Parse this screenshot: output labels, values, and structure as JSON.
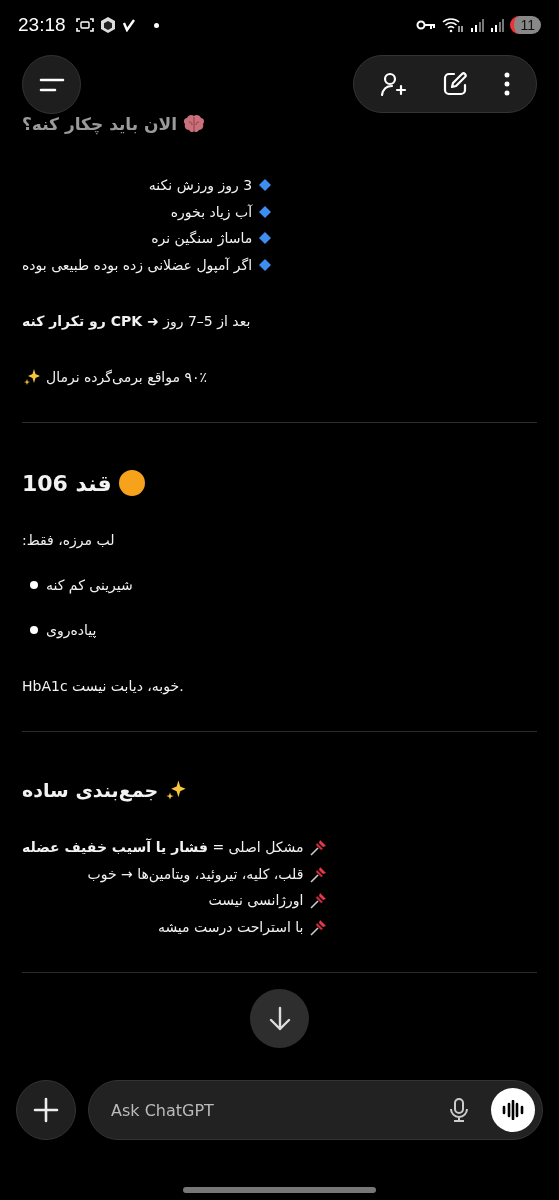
{
  "status_bar": {
    "time": "23:18",
    "battery": "11"
  },
  "sections": [
    {
      "heading": "الان باید چکار کنه؟",
      "tips": [
        "3 روز ورزش نکنه",
        "آب زیاد بخوره",
        "ماساژ سنگین نره",
        "اگر آمپول عضلانی زده بوده طبیعی بوده"
      ],
      "notes": [
        "بعد از 5–7 روز **➜ CPK رو تکرار کنه**",
        "۹۰٪ مواقع برمی‌گرده نرمال"
      ]
    },
    {
      "heading": "قند 106",
      "intro": "لب مرزه، فقط:",
      "bullets": [
        "شیرینی کم کنه",
        "پیاده‌روی"
      ],
      "note": "HbA1c خوبه، دیابت نیست."
    },
    {
      "heading": "جمع‌بندی ساده",
      "points": [
        "مشکل اصلی = **فشار یا آسیب خفیف عضله**",
        "قلب، کلیه، تیروئید، ویتامین‌ها → خوب",
        "اورژانسی نیست",
        "با استراحت درست میشه"
      ]
    }
  ],
  "composer": {
    "placeholder": "Ask ChatGPT"
  }
}
